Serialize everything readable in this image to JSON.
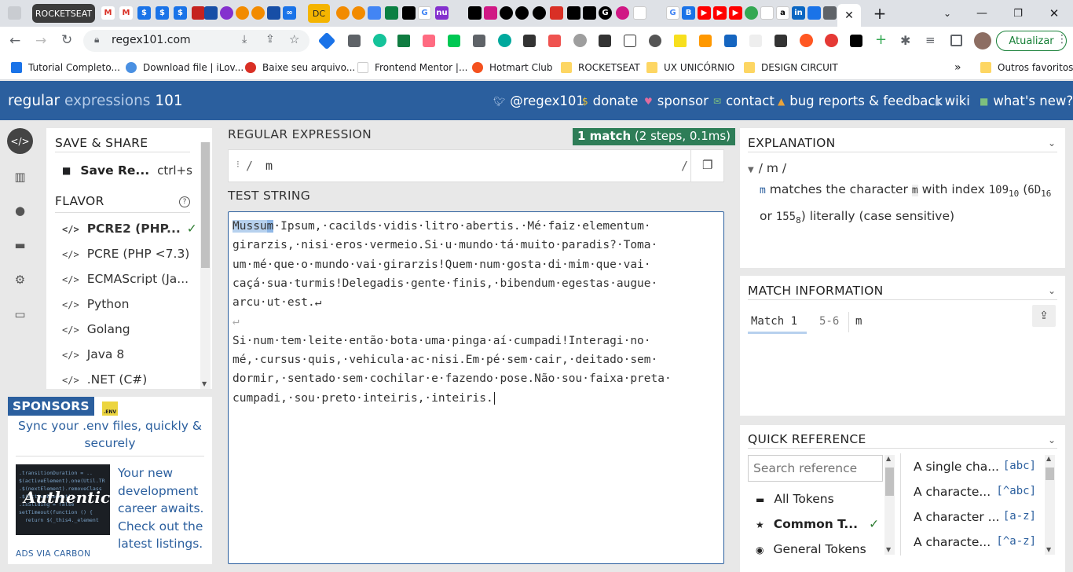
{
  "browser": {
    "active_tab": "ROCKETSEAT",
    "dc_tab": "DC",
    "url": "regex101.com",
    "update_button": "Atualizar",
    "bookmarks": [
      {
        "label": "Tutorial Completo..."
      },
      {
        "label": "Download file | iLov..."
      },
      {
        "label": "Baixe seu arquivo..."
      },
      {
        "label": "Frontend Mentor |..."
      },
      {
        "label": "Hotmart Club"
      },
      {
        "label": "ROCKETSEAT"
      },
      {
        "label": "UX UNICÓRNIO"
      },
      {
        "label": "DESIGN CIRCUIT"
      }
    ],
    "more_bookmarks": "»",
    "other_favorites": "Outros favoritos"
  },
  "site": {
    "logo_regular": "regular",
    "logo_expressions": " expressions",
    "logo_101": " 101",
    "nav": [
      {
        "label": "@regex101",
        "icon": "twitter-icon"
      },
      {
        "label": "donate",
        "icon": "dollar-icon"
      },
      {
        "label": "sponsor",
        "icon": "heart-icon"
      },
      {
        "label": "contact",
        "icon": "mail-icon"
      },
      {
        "label": "bug reports & feedback",
        "icon": "warning-icon"
      },
      {
        "label": "wiki",
        "icon": "book-icon"
      },
      {
        "label": "what's new?",
        "icon": "gift-icon"
      }
    ]
  },
  "left": {
    "save_share_title": "SAVE & SHARE",
    "save_label": "Save Re...",
    "save_shortcut": "ctrl+s",
    "flavor_title": "FLAVOR",
    "flavors": [
      {
        "label": "PCRE2 (PHP..."
      },
      {
        "label": "PCRE (PHP <7.3)"
      },
      {
        "label": "ECMAScript (Ja..."
      },
      {
        "label": "Python"
      },
      {
        "label": "Golang"
      },
      {
        "label": "Java 8"
      },
      {
        "label": ".NET (C#)"
      }
    ]
  },
  "sponsor": {
    "title": "SPONSORS",
    "env_badge": ".ENV",
    "env_text": "Sync your .env files, quickly & securely",
    "ad_text": "Your new development career awaits. Check out the latest listings.",
    "ad_image_text": "Authentic",
    "ads_via": "ADS VIA CARBON"
  },
  "regex": {
    "title": "REGULAR EXPRESSION",
    "match_count": "1 match",
    "match_stats": " (2 steps, 0.1ms)",
    "delimiter_open": "/",
    "pattern": "m",
    "delimiter_close": "/",
    "test_string_title": "TEST STRING",
    "test_lines": [
      "Mussum·Ipsum,·cacilds·vidis·litro·abertis.·Mé·faiz·elementum·",
      "girarzis,·nisi·eros·vermeio.Si·u·mundo·tá·muito·paradis?·Toma·",
      "um·mé·que·o·mundo·vai·girarzis!Quem·num·gosta·di·mim·que·vai·",
      "caçá·sua·turmis!Delegadis·gente·finis,·bibendum·egestas·augue·",
      "arcu·ut·est.↵",
      "↵",
      "Si·num·tem·leite·então·bota·uma·pinga·aí·cumpadi!Interagi·no·",
      "mé,·cursus·quis,·vehicula·ac·nisi.Em·pé·sem·cair,·deitado·sem·",
      "dormir,·sentado·sem·cochilar·e·fazendo·pose.Não·sou·faixa·preta·",
      "cumpadi,·sou·preto·inteiris,·inteiris."
    ]
  },
  "explanation": {
    "title": "EXPLANATION",
    "tree_root": "/ m /",
    "token": "m",
    "text1": " matches the character ",
    "char": "m",
    "text2": " with index ",
    "idx10": "109",
    "sub10": "10",
    "idx16": "6D",
    "sub16": "16",
    "or": "or ",
    "idx8": "155",
    "sub8": "8",
    "text3": ") literally (case sensitive)"
  },
  "match_info": {
    "title": "MATCH INFORMATION",
    "match_label": "Match 1",
    "range": "5-6",
    "value": "m"
  },
  "quick_ref": {
    "title": "QUICK REFERENCE",
    "search_placeholder": "Search reference",
    "categories": [
      {
        "label": "All Tokens",
        "icon": "stack-icon"
      },
      {
        "label": "Common T...",
        "icon": "star-icon"
      },
      {
        "label": "General Tokens",
        "icon": "target-icon"
      }
    ],
    "tokens": [
      {
        "desc": "A single cha...",
        "token": "[abc]"
      },
      {
        "desc": "A characte...",
        "token": "[^abc]"
      },
      {
        "desc": "A character ...",
        "token": "[a-z]"
      },
      {
        "desc": "A characte...",
        "token": "[^a-z]"
      }
    ]
  }
}
